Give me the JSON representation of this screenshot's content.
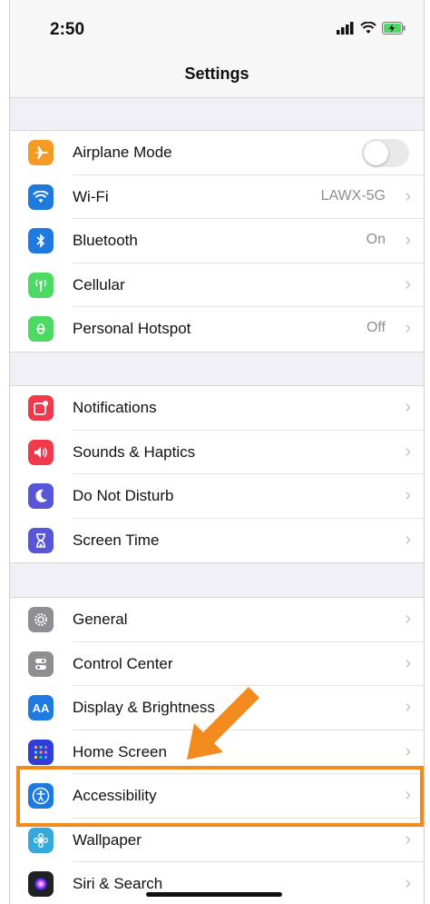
{
  "status": {
    "time": "2:50"
  },
  "nav": {
    "title": "Settings"
  },
  "groups": [
    {
      "rows": [
        {
          "label": "Airplane Mode",
          "icon": "airplane-icon",
          "color": "#f59a23",
          "control": "toggle",
          "toggle_on": false
        },
        {
          "label": "Wi-Fi",
          "icon": "wifi-icon",
          "color": "#1f7ae0",
          "value": "LAWX-5G"
        },
        {
          "label": "Bluetooth",
          "icon": "bluetooth-icon",
          "color": "#1f7ae0",
          "value": "On"
        },
        {
          "label": "Cellular",
          "icon": "cellular-icon",
          "color": "#4cd964",
          "value": ""
        },
        {
          "label": "Personal Hotspot",
          "icon": "hotspot-icon",
          "color": "#4cd964",
          "value": "Off"
        }
      ]
    },
    {
      "rows": [
        {
          "label": "Notifications",
          "icon": "notifications-icon",
          "color": "#f0394b",
          "value": ""
        },
        {
          "label": "Sounds & Haptics",
          "icon": "speaker-icon",
          "color": "#f0394b",
          "value": ""
        },
        {
          "label": "Do Not Disturb",
          "icon": "moon-icon",
          "color": "#5856d6",
          "value": ""
        },
        {
          "label": "Screen Time",
          "icon": "hourglass-icon",
          "color": "#5856d6",
          "value": ""
        }
      ]
    },
    {
      "rows": [
        {
          "label": "General",
          "icon": "gear-icon",
          "color": "#8e8e93",
          "value": ""
        },
        {
          "label": "Control Center",
          "icon": "control-center-icon",
          "color": "#8e8e93",
          "value": ""
        },
        {
          "label": "Display & Brightness",
          "icon": "display-icon",
          "color": "#1f7ae0",
          "icon_text": "AA",
          "value": ""
        },
        {
          "label": "Home Screen",
          "icon": "home-screen-icon",
          "color": "#2f3ed8",
          "value": ""
        },
        {
          "label": "Accessibility",
          "icon": "accessibility-icon",
          "color": "#1f7ae0",
          "value": ""
        },
        {
          "label": "Wallpaper",
          "icon": "wallpaper-icon",
          "color": "#34aadc",
          "value": ""
        },
        {
          "label": "Siri & Search",
          "icon": "siri-icon",
          "color": "#222222",
          "value": ""
        }
      ]
    }
  ],
  "annotation": {
    "color": "#f28b1e",
    "highlighted_item": "Accessibility"
  }
}
